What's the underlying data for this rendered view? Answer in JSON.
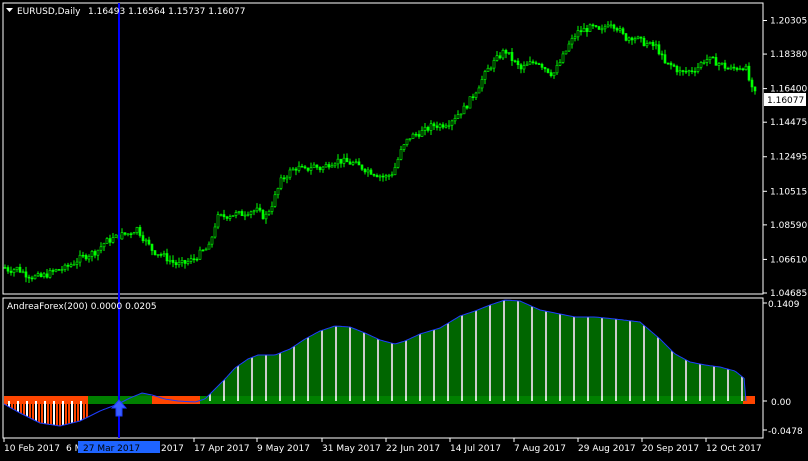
{
  "main_panel": {
    "symbol": "EURUSD,Daily",
    "ohlc": "1.16493 1.16564 1.15737 1.16077",
    "current_price": "1.16077",
    "price_levels": [
      "1.20305",
      "1.18380",
      "1.16400",
      "1.14475",
      "1.12495",
      "1.10515",
      "1.08590",
      "1.06610",
      "1.04685"
    ],
    "colors": {
      "bull": "#00ff00",
      "bear": "#00ff00",
      "background": "#000000",
      "grid": "#ffffff",
      "cursor": "#0000ff"
    }
  },
  "indicator_panel": {
    "label": "AndreaForex(200) 0.0000 0.0205",
    "levels": [
      "0.1409",
      "0.00",
      "-0.0478"
    ],
    "colors": {
      "positive": "#008000",
      "negative": "#ff4500",
      "line": "#1e3cff"
    }
  },
  "time_axis": {
    "labels": [
      "10 Feb 2017",
      "6 Mar 2017",
      "17 Apr 2017",
      "9 May 2017",
      "31 May 2017",
      "22 Jun 2017",
      "14 Jul 2017",
      "7 Aug 2017",
      "29 Aug 2017",
      "20 Sep 2017",
      "12 Oct 2017"
    ],
    "cursor_label": "27 Mar 2017",
    "cursor_label_trailing": "2017"
  },
  "chart_data": {
    "type": "candlestick",
    "title": "EURUSD,Daily",
    "ylim": [
      1.04685,
      1.2125
    ],
    "close_points": [
      [
        0,
        1.063
      ],
      [
        8,
        1.06
      ],
      [
        16,
        1.061
      ],
      [
        24,
        1.058
      ],
      [
        32,
        1.056
      ],
      [
        40,
        1.056
      ],
      [
        48,
        1.058
      ],
      [
        56,
        1.06
      ],
      [
        64,
        1.061
      ],
      [
        72,
        1.064
      ],
      [
        80,
        1.067
      ],
      [
        88,
        1.069
      ],
      [
        96,
        1.071
      ],
      [
        104,
        1.076
      ],
      [
        112,
        1.078
      ],
      [
        120,
        1.08
      ],
      [
        128,
        1.081
      ],
      [
        136,
        1.084
      ],
      [
        144,
        1.077
      ],
      [
        152,
        1.071
      ],
      [
        160,
        1.069
      ],
      [
        168,
        1.066
      ],
      [
        176,
        1.063
      ],
      [
        184,
        1.064
      ],
      [
        192,
        1.066
      ],
      [
        200,
        1.07
      ],
      [
        208,
        1.073
      ],
      [
        216,
        1.09
      ],
      [
        224,
        1.091
      ],
      [
        232,
        1.092
      ],
      [
        240,
        1.092
      ],
      [
        248,
        1.094
      ],
      [
        256,
        1.094
      ],
      [
        264,
        1.09
      ],
      [
        272,
        1.099
      ],
      [
        280,
        1.111
      ],
      [
        288,
        1.116
      ],
      [
        296,
        1.119
      ],
      [
        304,
        1.117
      ],
      [
        312,
        1.12
      ],
      [
        320,
        1.118
      ],
      [
        328,
        1.121
      ],
      [
        336,
        1.123
      ],
      [
        344,
        1.122
      ],
      [
        352,
        1.121
      ],
      [
        360,
        1.119
      ],
      [
        368,
        1.117
      ],
      [
        376,
        1.115
      ],
      [
        384,
        1.113
      ],
      [
        392,
        1.116
      ],
      [
        400,
        1.128
      ],
      [
        408,
        1.136
      ],
      [
        416,
        1.138
      ],
      [
        424,
        1.14
      ],
      [
        432,
        1.143
      ],
      [
        440,
        1.143
      ],
      [
        448,
        1.145
      ],
      [
        456,
        1.149
      ],
      [
        464,
        1.153
      ],
      [
        472,
        1.16
      ],
      [
        480,
        1.168
      ],
      [
        488,
        1.176
      ],
      [
        496,
        1.181
      ],
      [
        504,
        1.186
      ],
      [
        512,
        1.18
      ],
      [
        520,
        1.175
      ],
      [
        528,
        1.178
      ],
      [
        536,
        1.18
      ],
      [
        544,
        1.176
      ],
      [
        552,
        1.172
      ],
      [
        560,
        1.18
      ],
      [
        568,
        1.189
      ],
      [
        576,
        1.196
      ],
      [
        584,
        1.198
      ],
      [
        592,
        1.199
      ],
      [
        600,
        1.196
      ],
      [
        608,
        1.203
      ],
      [
        616,
        1.199
      ],
      [
        624,
        1.193
      ],
      [
        632,
        1.194
      ],
      [
        640,
        1.191
      ],
      [
        648,
        1.189
      ],
      [
        656,
        1.188
      ],
      [
        664,
        1.178
      ],
      [
        672,
        1.177
      ],
      [
        680,
        1.173
      ],
      [
        688,
        1.174
      ],
      [
        696,
        1.176
      ],
      [
        704,
        1.181
      ],
      [
        712,
        1.18
      ],
      [
        720,
        1.178
      ],
      [
        728,
        1.175
      ],
      [
        736,
        1.176
      ],
      [
        744,
        1.177
      ],
      [
        752,
        1.161
      ]
    ]
  }
}
